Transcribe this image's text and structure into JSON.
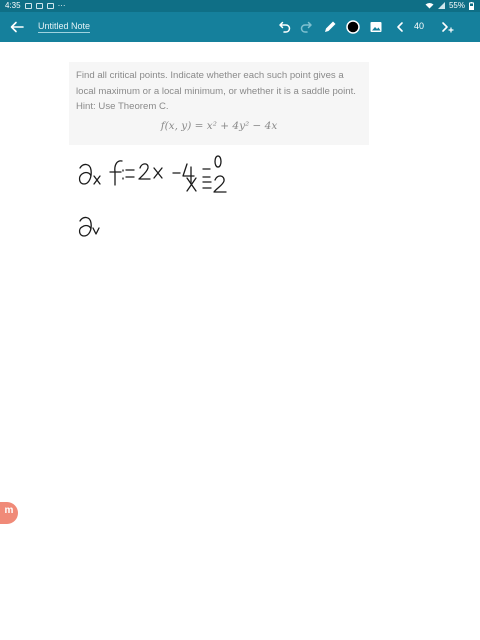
{
  "status_bar": {
    "time": "4:35",
    "dots": "···",
    "battery": "55%"
  },
  "app_bar": {
    "title": "Untitled Note",
    "page_number": "40"
  },
  "question": {
    "text": "Find all critical points. Indicate whether each such point gives a local maximum or a local minimum, or whether it is a saddle point. Hint: Use Theorem C.",
    "formula": "f(x, y) = x² + 4y² − 4x"
  },
  "logo": {
    "letter": "m"
  },
  "colors": {
    "status_bar": "#0f6f86",
    "app_bar": "#15809c",
    "logo": "#f08a78"
  }
}
